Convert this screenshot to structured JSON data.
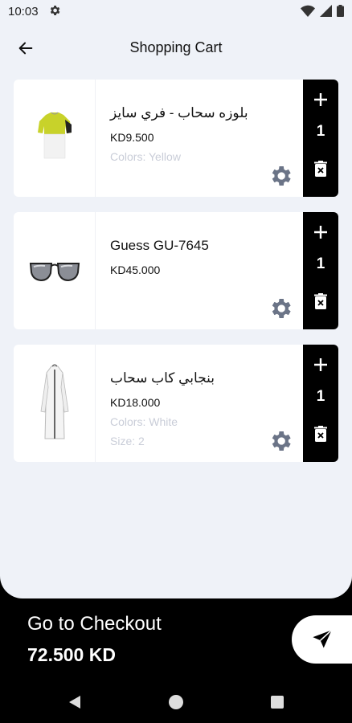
{
  "status": {
    "time": "10:03"
  },
  "header": {
    "title": "Shopping Cart"
  },
  "items": [
    {
      "name": "بلوزه سحاب - فري سايز",
      "price": "KD9.500",
      "color": "Colors: Yellow",
      "size": "",
      "quantity": "1"
    },
    {
      "name": "Guess GU-7645",
      "price": "KD45.000",
      "color": "",
      "size": "",
      "quantity": "1"
    },
    {
      "name": "بنجابي كاب سحاب",
      "price": "KD18.000",
      "color": "Colors: White",
      "size": "Size: 2",
      "quantity": "1"
    }
  ],
  "checkout": {
    "label": "Go to Checkout",
    "total": "72.500 KD"
  },
  "colors": {
    "background": "#eff2f8",
    "card": "#ffffff",
    "accent": "#000000",
    "muted_text": "#c9cdd8",
    "settings_icon": "#6b7487"
  },
  "icons": [
    "back-arrow-icon",
    "settings-gear-icon",
    "wifi-icon",
    "cellular-signal-icon",
    "battery-icon",
    "plus-icon",
    "delete-icon",
    "send-icon"
  ]
}
